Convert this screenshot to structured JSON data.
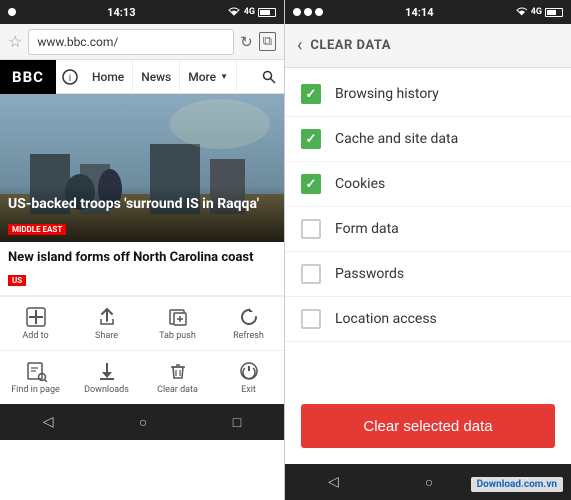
{
  "left": {
    "status_bar": {
      "time": "14:13",
      "icons": [
        "notification",
        "wifi",
        "4G",
        "battery"
      ]
    },
    "address_bar": {
      "url": "www.bbc.com/",
      "star_icon": "☆",
      "reload_icon": "↻",
      "tabs_icon": "⧉"
    },
    "bbc_nav": {
      "logo": "BBC",
      "home_label": "Home",
      "news_label": "News",
      "more_label": "More",
      "more_arrow": "▼",
      "search_icon": "🔍"
    },
    "hero": {
      "title": "US-backed troops 'surround IS in Raqqa'",
      "tag": "MIDDLE EAST"
    },
    "news_item": {
      "title": "New island forms off North Carolina coast",
      "tag": "US"
    },
    "toolbar_row1": [
      {
        "icon": "＋",
        "label": "Add to"
      },
      {
        "icon": "↑",
        "label": "Share"
      },
      {
        "icon": "⇥",
        "label": "Tab push"
      },
      {
        "icon": "↺",
        "label": "Refresh"
      }
    ],
    "toolbar_row2": [
      {
        "icon": "🔍",
        "label": "Find in page"
      },
      {
        "icon": "⬇",
        "label": "Downloads"
      },
      {
        "icon": "🗑",
        "label": "Clear data"
      },
      {
        "icon": "⏻",
        "label": "Exit"
      }
    ],
    "nav_bar": {
      "back": "◁",
      "home": "○",
      "recent": "□"
    }
  },
  "right": {
    "status_bar": {
      "time": "14:14",
      "icons": [
        "notification",
        "wifi",
        "4G",
        "battery"
      ]
    },
    "header": {
      "back_arrow": "‹",
      "title": "CLEAR DATA"
    },
    "checkboxes": [
      {
        "label": "Browsing history",
        "checked": true
      },
      {
        "label": "Cache and site data",
        "checked": true
      },
      {
        "label": "Cookies",
        "checked": true
      },
      {
        "label": "Form data",
        "checked": false
      },
      {
        "label": "Passwords",
        "checked": false
      },
      {
        "label": "Location access",
        "checked": false
      }
    ],
    "clear_button": "Clear selected data",
    "nav_bar": {
      "back": "◁",
      "home": "○",
      "recent": "□"
    },
    "watermark": "Download.com.vn"
  }
}
